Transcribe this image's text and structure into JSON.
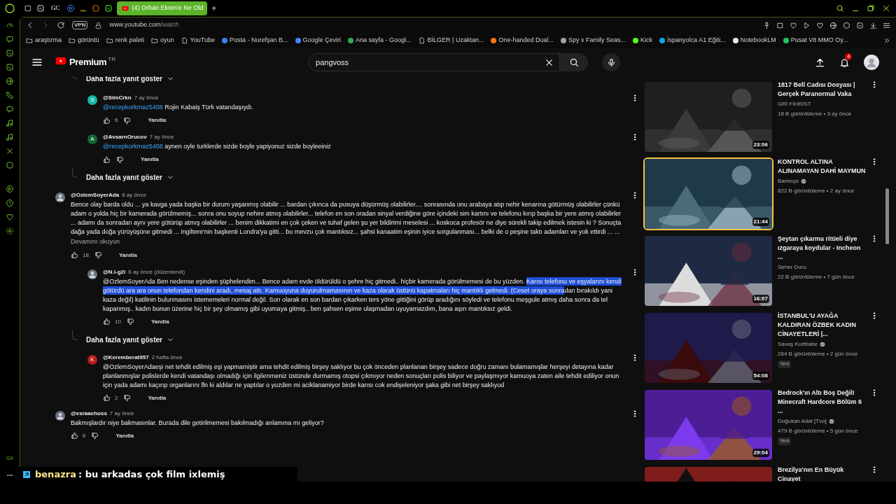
{
  "browser": {
    "tabs": [
      {
        "kind": "icon",
        "selected": false
      },
      {
        "kind": "icon",
        "selected": false
      },
      {
        "kind": "text",
        "label": "GC",
        "selected": false
      },
      {
        "kind": "icon",
        "selected": false
      },
      {
        "kind": "icon",
        "selected": false
      },
      {
        "kind": "icon",
        "selected": false
      },
      {
        "kind": "icon",
        "selected": false
      },
      {
        "kind": "page",
        "label": "(4) Orhan Ekren'e Ne Old",
        "selected": true
      }
    ],
    "new_tab": "+",
    "url_host": "www.youtube.com",
    "url_path": "/watch",
    "vpn": "VPN",
    "bookmarks": [
      {
        "kind": "folder",
        "label": "araştırma"
      },
      {
        "kind": "folder",
        "label": "görüntü"
      },
      {
        "kind": "folder",
        "label": "renk paleti"
      },
      {
        "kind": "folder",
        "label": "oyun"
      },
      {
        "kind": "page",
        "label": "YouTube"
      },
      {
        "kind": "site",
        "label": "Posta - Nurefşan B...",
        "color": "#3b82f6"
      },
      {
        "kind": "site",
        "label": "Google Çeviri",
        "color": "#4285f4"
      },
      {
        "kind": "site",
        "label": "Ana sayfa - Googl...",
        "color": "#34a853"
      },
      {
        "kind": "page",
        "label": "BİLGER | Uzaktan..."
      },
      {
        "kind": "site",
        "label": "One-handed Dual...",
        "color": "#f97316"
      },
      {
        "kind": "site",
        "label": "Spy x Family Seas...",
        "color": "#9ca3af"
      },
      {
        "kind": "site",
        "label": "Kick",
        "color": "#53fc18"
      },
      {
        "kind": "site",
        "label": "İspanyolca A1 Eğiti...",
        "color": "#0ea5e9"
      },
      {
        "kind": "site",
        "label": "NotebookLM",
        "color": "#e5e7eb"
      },
      {
        "kind": "site",
        "label": "Pusat V8 MMO Oy...",
        "color": "#22c55e"
      }
    ],
    "sidebar_label": "GX"
  },
  "header": {
    "logo": "Premium",
    "region": "TR",
    "search": "pangvoss",
    "notifications": "4"
  },
  "comments": [
    {
      "kind": "more_replies",
      "label": "Daha fazla yanıt göster"
    },
    {
      "kind": "reply",
      "author": "@SimCrkn",
      "time": "7 ay önce",
      "avatar": {
        "letter": "S",
        "color": "#14b8a6"
      },
      "mention": "@recepkorkmaz5408",
      "body": "Rojin Kabaiş Türk vatandaşıydı.",
      "likes": "6",
      "reply_label": "Yanıtla"
    },
    {
      "kind": "reply",
      "author": "@AvsarnOrucov",
      "time": "7 ay önce",
      "avatar": {
        "letter": "A",
        "color": "#166534"
      },
      "mention": "@recepkorkmaz5408",
      "body": "aynen oyle turklerde sizde boyle yapiyonuz sizde boyleeiniz",
      "reply_label": "Yanıtla"
    },
    {
      "kind": "more_replies",
      "label": "Daha fazla yanıt göster"
    },
    {
      "kind": "comment",
      "author": "@OzlemSoyerAda",
      "time": "6 ay önce",
      "body": "Bence olay barda oldu ... ya kavga yada başka bir durum yaşanmış olabilir ... bardan çıkınca da pusuya düşürmüş olabilirler.... sonrasında onu arabaya atıp nehir kenarına götürmüş olabilirler çünkü adam o yolda hiç bir kamerada görülmemiş... sonra onu soyup nehire atmış olabilirler... telefon en son oradan sinyal verdiğine göre içindeki sim kartını ve telefonu kırıp başka bir yere atmış olabilirler ... adamı da sonradan aynı yere götürüp atmış olabilirler ... benim dikkatimi en çok çeken ve tuhaf gelen şu yer bildirimi meselesi ... koskoca profesör ne diye sürekli takip edilmek istesin ki ? Sonuçta dağa yada doğa yürüyüşüne gitmedi ... ingiltere'nin başkenti Londra'ya gitti... bu mevzu çok mantıksız... şahsi kanaatim eşinin iyice sorgulanması... belki de o peşine taktı adamları ve yok ettirdi ... ...",
      "read_more": "Devamını okuyun",
      "likes": "18",
      "reply_label": "Yanıtla"
    },
    {
      "kind": "reply",
      "author": "@N.i-g2i",
      "time": "6 ay önce (düzenlendi)",
      "body_parts": [
        {
          "text": "@OzlemSoyerAda Ben nedense eşinden şüphelendim... Bence adam evde öldürüldü o şehre hiç gitmedi.. hiçbir kamerada görülmemesi de bu yüzden. ",
          "selected": false
        },
        {
          "text": "Karısı telefonu ve eşyalarını kendi götürdü ara ara onun telefondan kendini aradı, mesaj attı. Kamuoyuna duyurulmamasının ve kaza olarak üstünü kapatmaları hiç mantıklı gelmedi. (Ceset oraya sonra",
          "selected": true
        },
        {
          "text": "dan bırakıldı yani kaza değil) katilinin bulunmasını istememeleri normal değil. Son olarak en son bardan çıkarken ters yöne gittiğini görüp aradığını söyledi ve telefonu meşgule atmış daha sonra da tel kapanmış.. kadın bunun üzerine hiç bir şey olmamış gibi uyumaya gitmiş.. ben şahsen eşime ulaşmadan uyuyamazdım, bana aşırı mantıksız geldi.",
          "selected": false
        }
      ],
      "likes": "10",
      "reply_label": "Yanıtla"
    },
    {
      "kind": "more_replies",
      "label": "Daha fazla yanıt göster"
    },
    {
      "kind": "reply",
      "author": "@Keremberat957",
      "time": "2 hafta önce",
      "avatar": {
        "letter": "K",
        "color": "#b91c1c"
      },
      "body": "@OzlemSoyerAdaeşi net tehdit edilmiş eşi yapmamiştir ama tehdit edilmiş birşey saklıyor bu çok önceden planlanan birşey sadece doğru zamanı bulamamışlar herşeyi detayına kadar planlanmışlar polislerde kendi vatandaşı olmadığı için ilgilenmeniz üstünde durmamış otopsi çıkmıyor neden sonuçları polis biliyor ve paylaşmıyor kamuoya zaten aile tehdit ediliyor onun için yada adamı kaçırıp organlarını fln ki aldılar ne yaptılar o yuzden mi aciklanamiyor birde karısı cok endişeleniyor şaka gibi net birşey saklıyod",
      "likes": "2",
      "reply_label": "Yanıtla"
    },
    {
      "kind": "comment",
      "author": "@esraachoss",
      "time": "7 ay önce",
      "body": "Bakmışlardır niye bakmasınlar. Burada dile getirilmemesi bakılmadığı anlamına mı geliyor?",
      "likes": "6",
      "reply_label": "Yanıtla"
    }
  ],
  "videos": [
    {
      "title": "1817 Bell Cadısı Dosyası | Gerçek Paranormal Vaka",
      "channel": "GRİ FİHRİST",
      "verified": false,
      "meta": "18 B görüntüleme • 3 ay önce",
      "duration": "23:06",
      "selected": false
    },
    {
      "title": "KONTROL ALTINA ALINAMAYAN DAHİ MAYMUN",
      "channel": "Bamropi",
      "verified": true,
      "meta": "822 B görüntüleme • 2 ay önce",
      "duration": "21:44",
      "selected": true
    },
    {
      "title": "Şeytan çıkarma ritüeli diye ızgaraya koydular - Incheon ...",
      "channel": "Seher Duru",
      "verified": false,
      "meta": "22 B görüntüleme • 7 gün önce",
      "duration": "16:07",
      "selected": false
    },
    {
      "title": "İSTANBUL'U AYAĞA KALDIRAN ÖZBEK KADIN CİNAYETLERİ |...",
      "channel": "Savaş Kurtbabe",
      "verified": true,
      "meta": "264 B görüntüleme • 2 gün önce",
      "badge": "Yeni",
      "duration": "54:08",
      "selected": false
    },
    {
      "title": "Bedrock'ın Altı Boş Değil! Minecraft Hardcore Bölüm 6 ...",
      "channel": "Doğukan Adal [Tvo]",
      "verified": true,
      "meta": "479 B görüntüleme • 5 gün önce",
      "badge": "Yeni",
      "duration": "29:04",
      "selected": false
    },
    {
      "title": "Brezilya'nın En Büyük Cinayet",
      "selected": false
    }
  ],
  "chat": {
    "user": "benazra",
    "message": ": bu arkadas çok film ixlemiş"
  }
}
